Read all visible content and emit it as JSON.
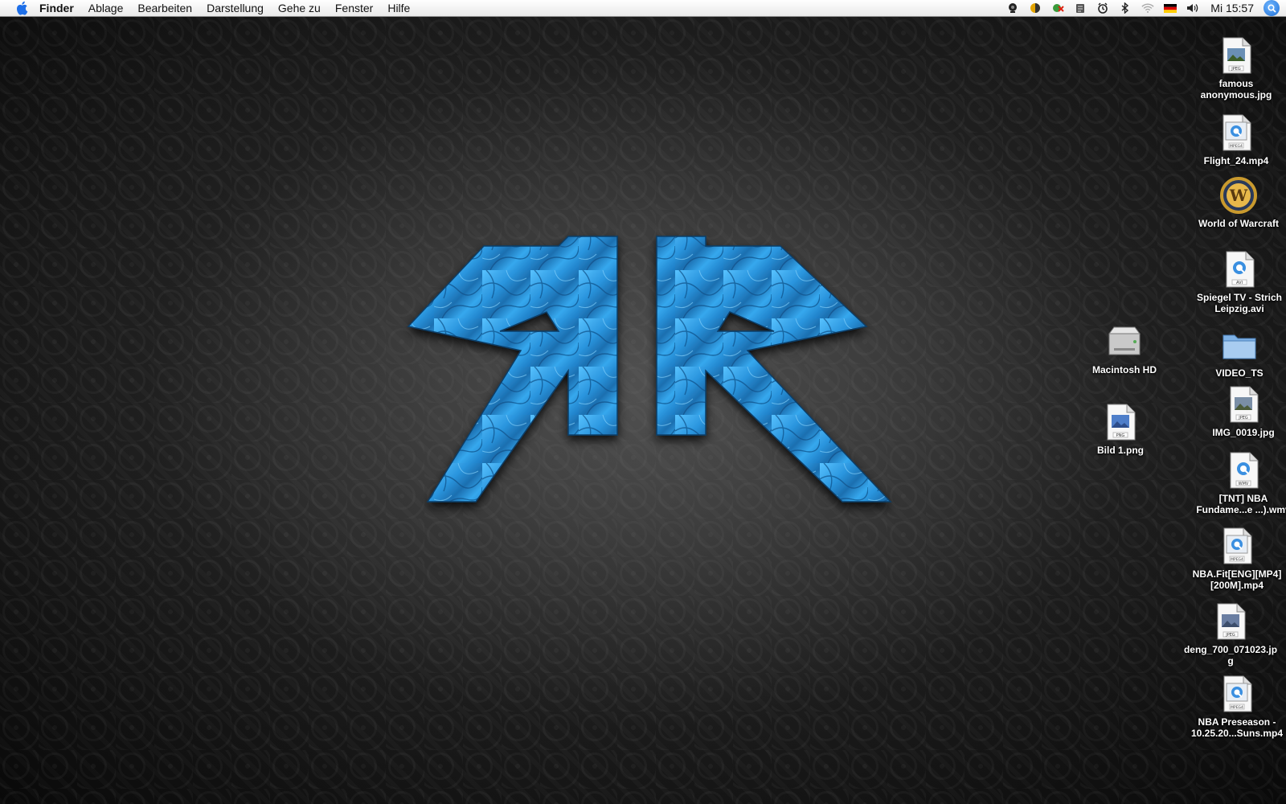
{
  "menubar": {
    "app_name": "Finder",
    "items": [
      "Ablage",
      "Bearbeiten",
      "Darstellung",
      "Gehe zu",
      "Fenster",
      "Hilfe"
    ],
    "clock": "Mi 15:57"
  },
  "desktop": {
    "icons": [
      {
        "label": "famous\nanonymous.jpg",
        "type": "jpeg"
      },
      {
        "label": "Flight_24.mp4",
        "type": "mpeg4"
      },
      {
        "label": "World of Warcraft",
        "type": "app"
      },
      {
        "label": "Spiegel TV - Strich\nLeipzig.avi",
        "type": "avi"
      },
      {
        "label": "VIDEO_TS",
        "type": "folder"
      },
      {
        "label": "IMG_0019.jpg",
        "type": "jpeg"
      },
      {
        "label": "[TNT] NBA\nFundame...e ...).wmv",
        "type": "wmv"
      },
      {
        "label": "NBA.Fit[ENG][MP4]\n[200M].mp4",
        "type": "mpeg4"
      },
      {
        "label": "deng_700_071023.jp\ng",
        "type": "jpeg"
      },
      {
        "label": "NBA Preseason -\n10.25.20...Suns.mp4",
        "type": "mpeg4"
      },
      {
        "label": "Macintosh HD",
        "type": "disk"
      },
      {
        "label": "Bild 1.png",
        "type": "png"
      }
    ]
  },
  "file_badges": {
    "jpeg": "JPEG",
    "mpeg4": "MPEG4",
    "avi": "AVI",
    "wmv": "WMV",
    "png": "PNG"
  },
  "colors": {
    "logo_blue": "#2f9fe3",
    "logo_dark": "#135e9a",
    "menubar": "#f2f2f2"
  }
}
